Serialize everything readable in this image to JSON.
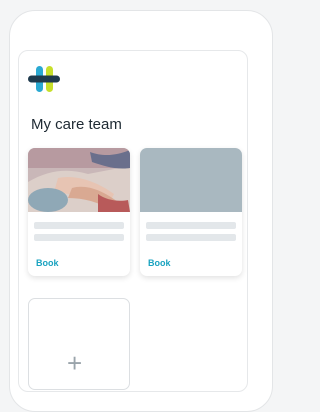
{
  "page": {
    "title": "My care team"
  },
  "care_team": {
    "cards": [
      {
        "book_label": "Book"
      },
      {
        "book_label": "Book"
      }
    ],
    "add_symbol": "+"
  },
  "colors": {
    "accent": "#1aa3c0",
    "logo_blue": "#2d7fd6",
    "logo_lime": "#c7df2b",
    "logo_navy": "#1f3a4d",
    "placeholder_photo": "#a9b8c0"
  },
  "icons": {
    "logo": "app-logo-icon",
    "add": "plus-icon"
  }
}
